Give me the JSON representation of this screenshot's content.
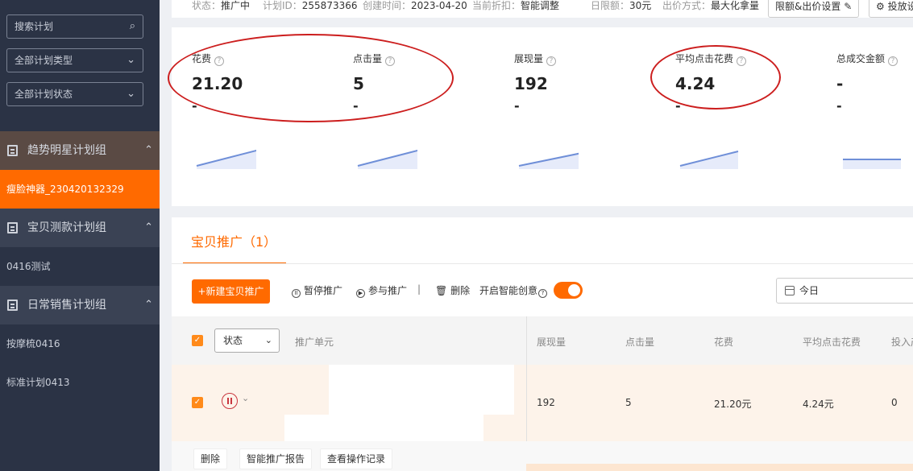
{
  "sidebar": {
    "search_placeholder": "搜索计划",
    "type_filter": "全部计划类型",
    "status_filter": "全部计划状态",
    "groups": [
      {
        "label": "趋势明星计划组",
        "items": [
          "瘦脸神器_230420132329"
        ]
      },
      {
        "label": "宝贝测款计划组",
        "items": [
          "0416测试"
        ]
      },
      {
        "label": "日常销售计划组",
        "items": [
          "按摩梳0416",
          "标准计划0413"
        ]
      }
    ]
  },
  "topbar": {
    "status_key": "状态：",
    "status_val": "推广中",
    "id_key": "计划ID：",
    "id_val": "255873366",
    "created_key": "创建时间：",
    "created_val": "2023-04-20",
    "discount_key": "当前折扣：",
    "discount_val": "智能调整",
    "daily_key": "日限额：",
    "daily_val": "30元",
    "bid_key": "出价方式：",
    "bid_val": "最大化拿量",
    "limit_btn": "限额&出价设置",
    "deliver_btn": "投放设置"
  },
  "metrics": [
    {
      "label": "花费",
      "value": "21.20",
      "compare": "-"
    },
    {
      "label": "点击量",
      "value": "5",
      "compare": "-"
    },
    {
      "label": "展现量",
      "value": "192",
      "compare": "-"
    },
    {
      "label": "平均点击花费",
      "value": "4.24",
      "compare": "-"
    },
    {
      "label": "总成交金额",
      "value": "-",
      "compare": "-"
    }
  ],
  "card": {
    "tab": "宝贝推广（1）",
    "new_btn": "+新建宝贝推广",
    "pause": "暂停推广",
    "join": "参与推广",
    "delete": "删除",
    "smart": "开启智能创意",
    "date": "今日"
  },
  "table": {
    "status_select": "状态",
    "headers": [
      "推广单元",
      "展现量",
      "点击量",
      "花费",
      "平均点击花费",
      "投入产出比"
    ],
    "row": {
      "impressions": "192",
      "clicks": "5",
      "cost": "21.20元",
      "cpc": "4.24元",
      "roi": "0"
    }
  },
  "footer": {
    "delete": "删除",
    "report": "智能推广报告",
    "log": "查看操作记录"
  },
  "colors": {
    "accent": "#ff6a00",
    "sidebar": "#2b3345",
    "annotation": "#cc1e1e"
  }
}
